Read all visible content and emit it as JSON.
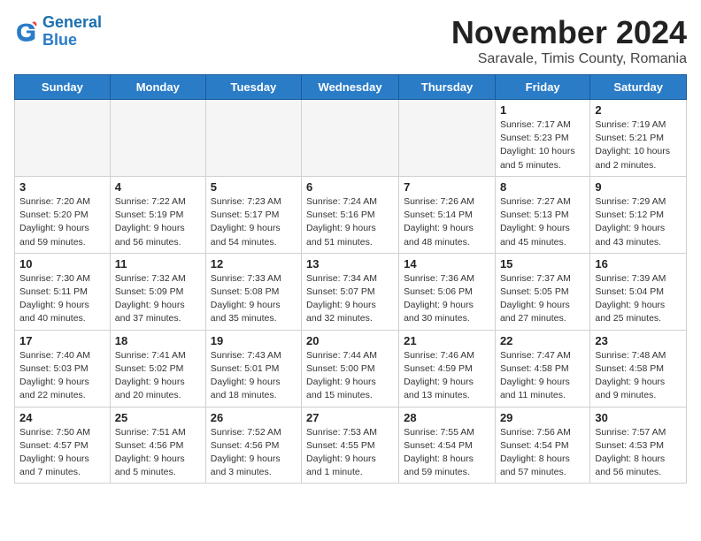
{
  "logo": {
    "line1": "General",
    "line2": "Blue"
  },
  "header": {
    "month": "November 2024",
    "location": "Saravale, Timis County, Romania"
  },
  "weekdays": [
    "Sunday",
    "Monday",
    "Tuesday",
    "Wednesday",
    "Thursday",
    "Friday",
    "Saturday"
  ],
  "weeks": [
    [
      {
        "day": "",
        "info": ""
      },
      {
        "day": "",
        "info": ""
      },
      {
        "day": "",
        "info": ""
      },
      {
        "day": "",
        "info": ""
      },
      {
        "day": "",
        "info": ""
      },
      {
        "day": "1",
        "info": "Sunrise: 7:17 AM\nSunset: 5:23 PM\nDaylight: 10 hours\nand 5 minutes."
      },
      {
        "day": "2",
        "info": "Sunrise: 7:19 AM\nSunset: 5:21 PM\nDaylight: 10 hours\nand 2 minutes."
      }
    ],
    [
      {
        "day": "3",
        "info": "Sunrise: 7:20 AM\nSunset: 5:20 PM\nDaylight: 9 hours\nand 59 minutes."
      },
      {
        "day": "4",
        "info": "Sunrise: 7:22 AM\nSunset: 5:19 PM\nDaylight: 9 hours\nand 56 minutes."
      },
      {
        "day": "5",
        "info": "Sunrise: 7:23 AM\nSunset: 5:17 PM\nDaylight: 9 hours\nand 54 minutes."
      },
      {
        "day": "6",
        "info": "Sunrise: 7:24 AM\nSunset: 5:16 PM\nDaylight: 9 hours\nand 51 minutes."
      },
      {
        "day": "7",
        "info": "Sunrise: 7:26 AM\nSunset: 5:14 PM\nDaylight: 9 hours\nand 48 minutes."
      },
      {
        "day": "8",
        "info": "Sunrise: 7:27 AM\nSunset: 5:13 PM\nDaylight: 9 hours\nand 45 minutes."
      },
      {
        "day": "9",
        "info": "Sunrise: 7:29 AM\nSunset: 5:12 PM\nDaylight: 9 hours\nand 43 minutes."
      }
    ],
    [
      {
        "day": "10",
        "info": "Sunrise: 7:30 AM\nSunset: 5:11 PM\nDaylight: 9 hours\nand 40 minutes."
      },
      {
        "day": "11",
        "info": "Sunrise: 7:32 AM\nSunset: 5:09 PM\nDaylight: 9 hours\nand 37 minutes."
      },
      {
        "day": "12",
        "info": "Sunrise: 7:33 AM\nSunset: 5:08 PM\nDaylight: 9 hours\nand 35 minutes."
      },
      {
        "day": "13",
        "info": "Sunrise: 7:34 AM\nSunset: 5:07 PM\nDaylight: 9 hours\nand 32 minutes."
      },
      {
        "day": "14",
        "info": "Sunrise: 7:36 AM\nSunset: 5:06 PM\nDaylight: 9 hours\nand 30 minutes."
      },
      {
        "day": "15",
        "info": "Sunrise: 7:37 AM\nSunset: 5:05 PM\nDaylight: 9 hours\nand 27 minutes."
      },
      {
        "day": "16",
        "info": "Sunrise: 7:39 AM\nSunset: 5:04 PM\nDaylight: 9 hours\nand 25 minutes."
      }
    ],
    [
      {
        "day": "17",
        "info": "Sunrise: 7:40 AM\nSunset: 5:03 PM\nDaylight: 9 hours\nand 22 minutes."
      },
      {
        "day": "18",
        "info": "Sunrise: 7:41 AM\nSunset: 5:02 PM\nDaylight: 9 hours\nand 20 minutes."
      },
      {
        "day": "19",
        "info": "Sunrise: 7:43 AM\nSunset: 5:01 PM\nDaylight: 9 hours\nand 18 minutes."
      },
      {
        "day": "20",
        "info": "Sunrise: 7:44 AM\nSunset: 5:00 PM\nDaylight: 9 hours\nand 15 minutes."
      },
      {
        "day": "21",
        "info": "Sunrise: 7:46 AM\nSunset: 4:59 PM\nDaylight: 9 hours\nand 13 minutes."
      },
      {
        "day": "22",
        "info": "Sunrise: 7:47 AM\nSunset: 4:58 PM\nDaylight: 9 hours\nand 11 minutes."
      },
      {
        "day": "23",
        "info": "Sunrise: 7:48 AM\nSunset: 4:58 PM\nDaylight: 9 hours\nand 9 minutes."
      }
    ],
    [
      {
        "day": "24",
        "info": "Sunrise: 7:50 AM\nSunset: 4:57 PM\nDaylight: 9 hours\nand 7 minutes."
      },
      {
        "day": "25",
        "info": "Sunrise: 7:51 AM\nSunset: 4:56 PM\nDaylight: 9 hours\nand 5 minutes."
      },
      {
        "day": "26",
        "info": "Sunrise: 7:52 AM\nSunset: 4:56 PM\nDaylight: 9 hours\nand 3 minutes."
      },
      {
        "day": "27",
        "info": "Sunrise: 7:53 AM\nSunset: 4:55 PM\nDaylight: 9 hours\nand 1 minute."
      },
      {
        "day": "28",
        "info": "Sunrise: 7:55 AM\nSunset: 4:54 PM\nDaylight: 8 hours\nand 59 minutes."
      },
      {
        "day": "29",
        "info": "Sunrise: 7:56 AM\nSunset: 4:54 PM\nDaylight: 8 hours\nand 57 minutes."
      },
      {
        "day": "30",
        "info": "Sunrise: 7:57 AM\nSunset: 4:53 PM\nDaylight: 8 hours\nand 56 minutes."
      }
    ]
  ]
}
